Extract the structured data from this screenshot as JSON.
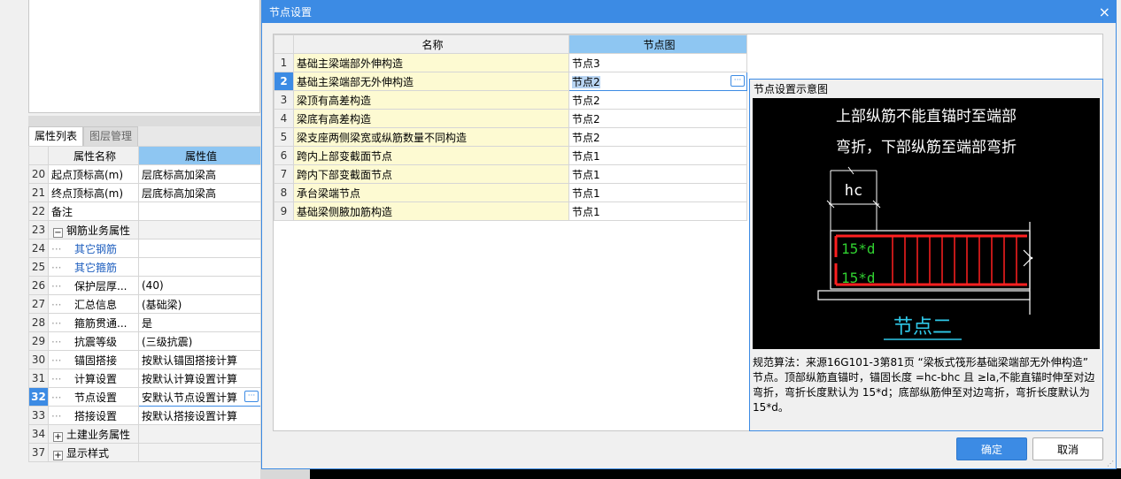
{
  "dialog": {
    "title": "节点设置",
    "close_glyph": "×",
    "ok_label": "确定",
    "cancel_label": "取消"
  },
  "node_table": {
    "headers": {
      "name": "名称",
      "figure": "节点图"
    },
    "rows": [
      {
        "n": "1",
        "name": "基础主梁端部外伸构造",
        "figure": "节点3"
      },
      {
        "n": "2",
        "name": "基础主梁端部无外伸构造",
        "figure": "节点2"
      },
      {
        "n": "3",
        "name": "梁顶有高差构造",
        "figure": "节点2"
      },
      {
        "n": "4",
        "name": "梁底有高差构造",
        "figure": "节点2"
      },
      {
        "n": "5",
        "name": "梁支座两侧梁宽或纵筋数量不同构造",
        "figure": "节点2"
      },
      {
        "n": "6",
        "name": "跨内上部变截面节点",
        "figure": "节点1"
      },
      {
        "n": "7",
        "name": "跨内下部变截面节点",
        "figure": "节点1"
      },
      {
        "n": "8",
        "name": "承台梁端节点",
        "figure": "节点1"
      },
      {
        "n": "9",
        "name": "基础梁侧腋加筋构造",
        "figure": "节点1"
      }
    ],
    "selected_row": 2
  },
  "diagram": {
    "panel_title": "节点设置示意图",
    "caption_line1": "上部纵筋不能直锚时至端部",
    "caption_line2": "弯折，下部纵筋至端部弯折",
    "dim_label": "hc",
    "bend_top": "15*d",
    "bend_bottom": "15*d",
    "node_name": "节点二",
    "description": "规范算法：来源16G101-3第81页 “梁板式筏形基础梁端部无外伸构造” 节点。顶部纵筋直锚时，锚固长度 =hc-bhc 且 ≥la,不能直锚时伸至对边弯折，弯折长度默认为 15*d；底部纵筋伸至对边弯折，弯折长度默认为15*d。"
  },
  "left_panel": {
    "tabs": {
      "active": "属性列表",
      "inactive": "图层管理"
    },
    "headers": {
      "name": "属性名称",
      "value": "属性值"
    },
    "rows": [
      {
        "n": "20",
        "name": "起点顶标高(m)",
        "value": "层底标高加梁高"
      },
      {
        "n": "21",
        "name": "终点顶标高(m)",
        "value": "层底标高加梁高"
      },
      {
        "n": "22",
        "name": "备注",
        "value": ""
      },
      {
        "n": "23",
        "name": "钢筋业务属性",
        "value": ""
      },
      {
        "n": "24",
        "name": "其它钢筋",
        "value": ""
      },
      {
        "n": "25",
        "name": "其它箍筋",
        "value": ""
      },
      {
        "n": "26",
        "name": "保护层厚...",
        "value": "(40)"
      },
      {
        "n": "27",
        "name": "汇总信息",
        "value": "(基础梁)"
      },
      {
        "n": "28",
        "name": "箍筋贯通...",
        "value": "是"
      },
      {
        "n": "29",
        "name": "抗震等级",
        "value": "(三级抗震)"
      },
      {
        "n": "30",
        "name": "锚固搭接",
        "value": "按默认锚固搭接计算"
      },
      {
        "n": "31",
        "name": "计算设置",
        "value": "按默认计算设置计算"
      },
      {
        "n": "32",
        "name": "节点设置",
        "value": "安默认节点设置计算"
      },
      {
        "n": "33",
        "name": "搭接设置",
        "value": "按默认搭接设置计算"
      },
      {
        "n": "34",
        "name": "土建业务属性",
        "value": ""
      },
      {
        "n": "37",
        "name": "显示样式",
        "value": ""
      }
    ],
    "expander_minus": "−",
    "expander_plus": "+",
    "ellipsis": "···"
  },
  "colors": {
    "accent": "#3c8be4",
    "header_highlight": "#8ec6f2",
    "name_cell_bg": "#fdfad2",
    "rebar_red": "#ff2020",
    "label_green": "#30d030",
    "node_name_cyan": "#2fc8e8"
  }
}
